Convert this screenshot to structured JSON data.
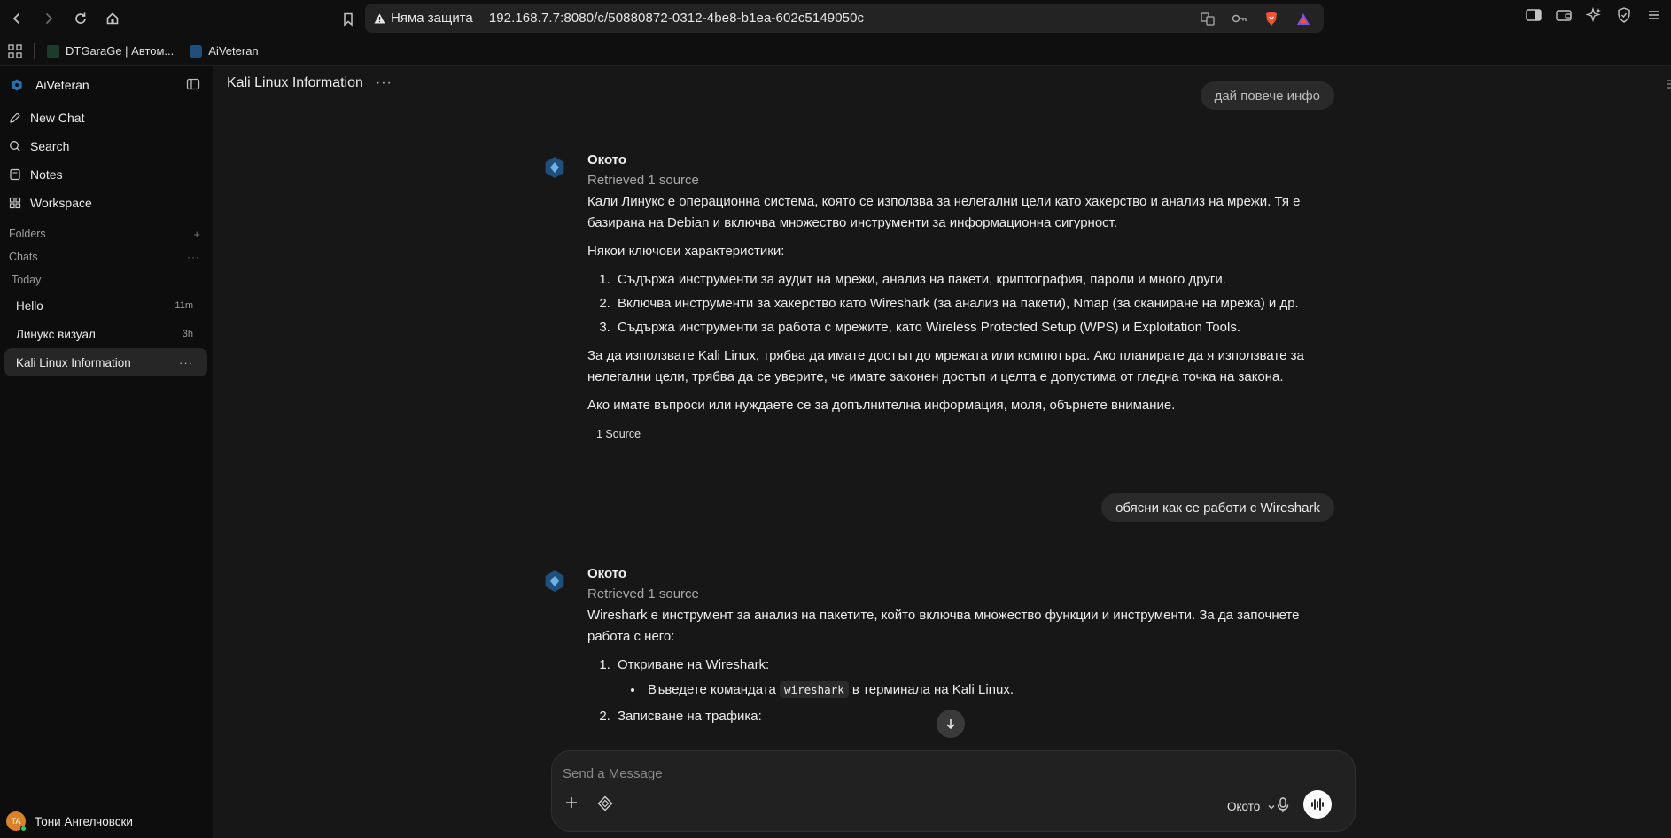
{
  "browser": {
    "security_label": "Няма защита",
    "url": "192.168.7.7:8080/c/50880872-0312-4be8-b1ea-602c5149050c",
    "bookmarks": [
      {
        "label": "DTGaraGe | Автом..."
      },
      {
        "label": "AiVeteran"
      }
    ]
  },
  "sidebar": {
    "app_name": "AiVeteran",
    "menu": [
      {
        "label": "New Chat"
      },
      {
        "label": "Search"
      },
      {
        "label": "Notes"
      },
      {
        "label": "Workspace"
      }
    ],
    "folders_label": "Folders",
    "chats_label": "Chats",
    "today_label": "Today",
    "chats": [
      {
        "title": "Hello",
        "time": "11m"
      },
      {
        "title": "Линукс визуал",
        "time": "3h"
      },
      {
        "title": "Kali Linux Information",
        "time": ""
      }
    ],
    "user_initials": "TA",
    "user_name": "Тони Ангелчовски"
  },
  "chat": {
    "title": "Kali Linux Information",
    "user_msg_1": "дай повече инфо",
    "bot_name": "Окото",
    "retrieved": "Retrieved 1 source",
    "answer_1": {
      "p1": "Кали Линукс е операционна система, която се използва за нелегални цели като хакерство и анализ на мрежи. Тя е базирана на Debian и включва множество инструменти за информационна сигурност.",
      "p2": "Някои ключови характеристики:",
      "list": [
        "Съдържа инструменти за аудит на мрежи, анализ на пакети, криптография, пароли и много други.",
        "Включва инструменти за хакерство като Wireshark (за анализ на пакети), Nmap (за сканиране на мрежа) и др.",
        "Съдържа инструменти за работа с мрежите, като Wireless Protected Setup (WPS) и Exploitation Tools."
      ],
      "p3": "За да използвате Kali Linux, трябва да имате достъп до мрежата или компютъра. Ако планирате да я използвате за нелегални цели, трябва да се уверите, че имате законен достъп и целта е допустима от гледна точка на закона.",
      "p4": "Ако имате въпроси или нуждаете се за допълнителна информация, моля, обърнете внимание.",
      "sources": "1 Source"
    },
    "user_msg_2": "обясни как се работи с Wireshark",
    "answer_2": {
      "p1": "Wireshark е инструмент за анализ на пакетите, който включва множество функции и инструменти. За да започнете работа с него:",
      "step1": "Откриване на Wireshark:",
      "step1_sub_pre": "Въведете командата",
      "step1_code": "wireshark",
      "step1_sub_post": "в терминала на Kali Linux.",
      "step2": "Записване на трафика:"
    }
  },
  "composer": {
    "placeholder": "Send a Message",
    "model": "Окото"
  }
}
